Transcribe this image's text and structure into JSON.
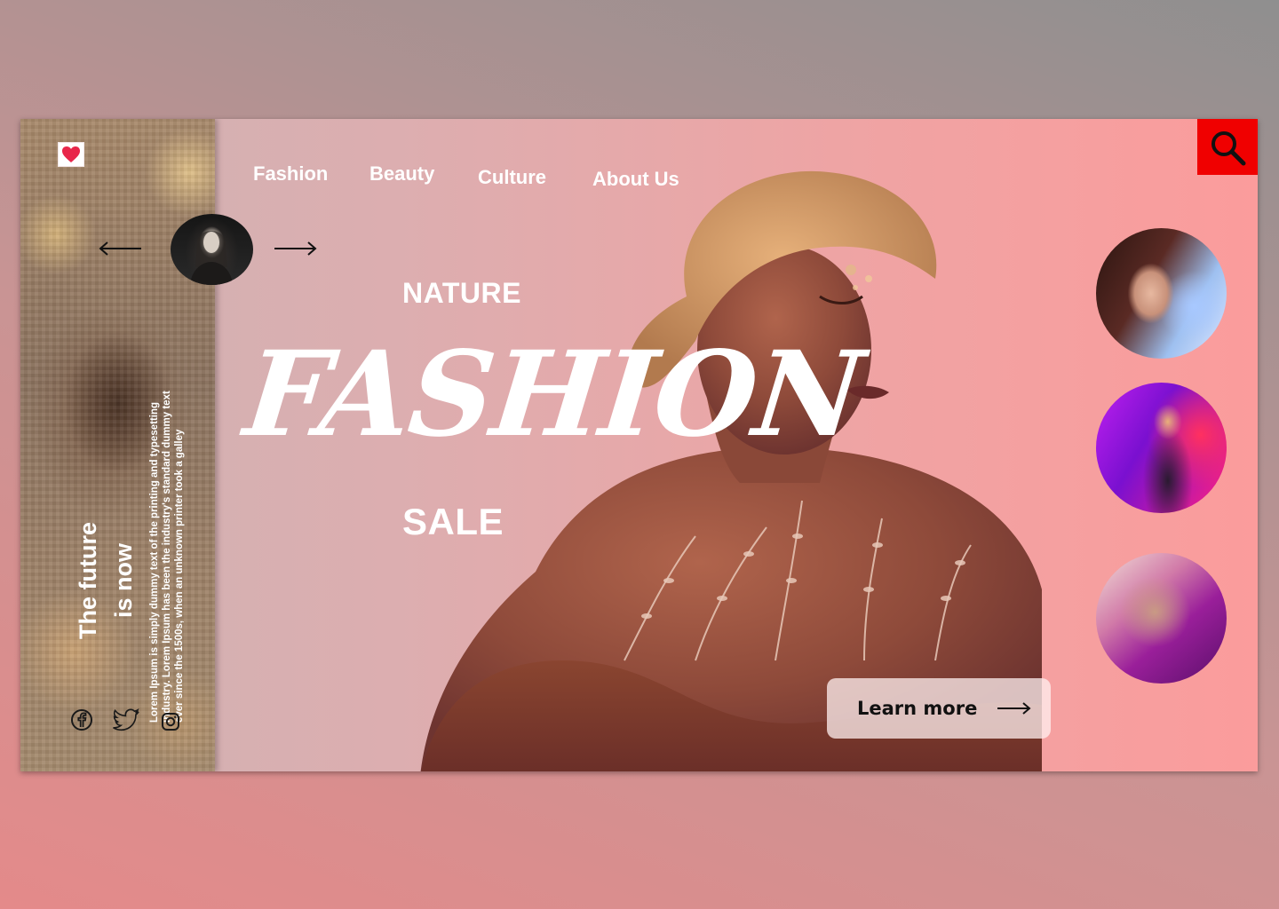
{
  "nav": {
    "items": [
      "Fashion",
      "Beauty",
      "Culture",
      "About Us"
    ]
  },
  "sidebar": {
    "title_line1": "The future",
    "title_line2": "is now",
    "lorem": "Lorem Ipsum is simply dummy text of the printing and typesetting industry. Lorem Ipsum has been the industry's standard dummy text ever since the 1500s, when an unknown printer took a galley",
    "social": [
      "facebook-icon",
      "twitter-icon",
      "instagram-icon"
    ]
  },
  "hero": {
    "kicker": "NATURE",
    "headline": "FASHION",
    "sub": "SALE",
    "cta_label": "Learn more"
  },
  "colors": {
    "search_bg": "#f00000",
    "card_start": "#cfb2b3",
    "card_end": "#fb9c9c"
  }
}
